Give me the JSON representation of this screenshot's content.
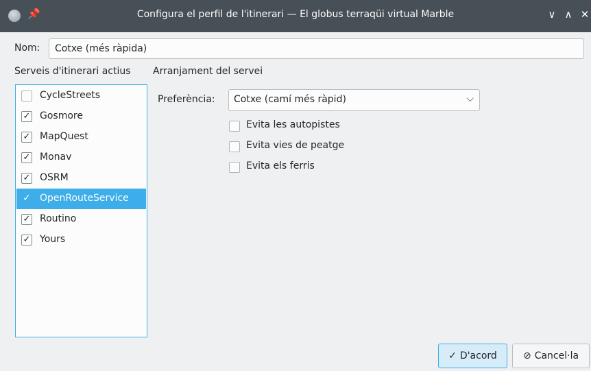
{
  "window": {
    "title": "Configura el perfil de l'itinerari — El globus terraqüi virtual Marble",
    "pin_glyph": "📌",
    "minimize_glyph": "∨",
    "maximize_glyph": "∧",
    "close_glyph": "✕"
  },
  "name_field": {
    "label": "Nom:",
    "value": "Cotxe (més ràpida)"
  },
  "services": {
    "heading": "Serveis d'itinerari actius",
    "items": [
      {
        "label": "CycleStreets",
        "checked": false,
        "selected": false
      },
      {
        "label": "Gosmore",
        "checked": true,
        "selected": false
      },
      {
        "label": "MapQuest",
        "checked": true,
        "selected": false
      },
      {
        "label": "Monav",
        "checked": true,
        "selected": false
      },
      {
        "label": "OSRM",
        "checked": true,
        "selected": false
      },
      {
        "label": "OpenRouteService",
        "checked": true,
        "selected": true
      },
      {
        "label": "Routino",
        "checked": true,
        "selected": false
      },
      {
        "label": "Yours",
        "checked": true,
        "selected": false
      }
    ]
  },
  "settings": {
    "heading": "Arranjament del servei",
    "preference_label": "Preferència:",
    "preference_value": "Cotxe (camí més ràpid)",
    "options": [
      {
        "label": "Evita les autopistes",
        "checked": false
      },
      {
        "label": "Evita vies de peatge",
        "checked": false
      },
      {
        "label": "Evita els ferris",
        "checked": false
      }
    ]
  },
  "buttons": {
    "ok_label": "D'acord",
    "ok_glyph": "✓",
    "cancel_label": "Cancel·la",
    "cancel_glyph": "⊘"
  },
  "colors": {
    "accent": "#3daee9",
    "titlebar": "#475057",
    "background": "#eff0f1"
  }
}
